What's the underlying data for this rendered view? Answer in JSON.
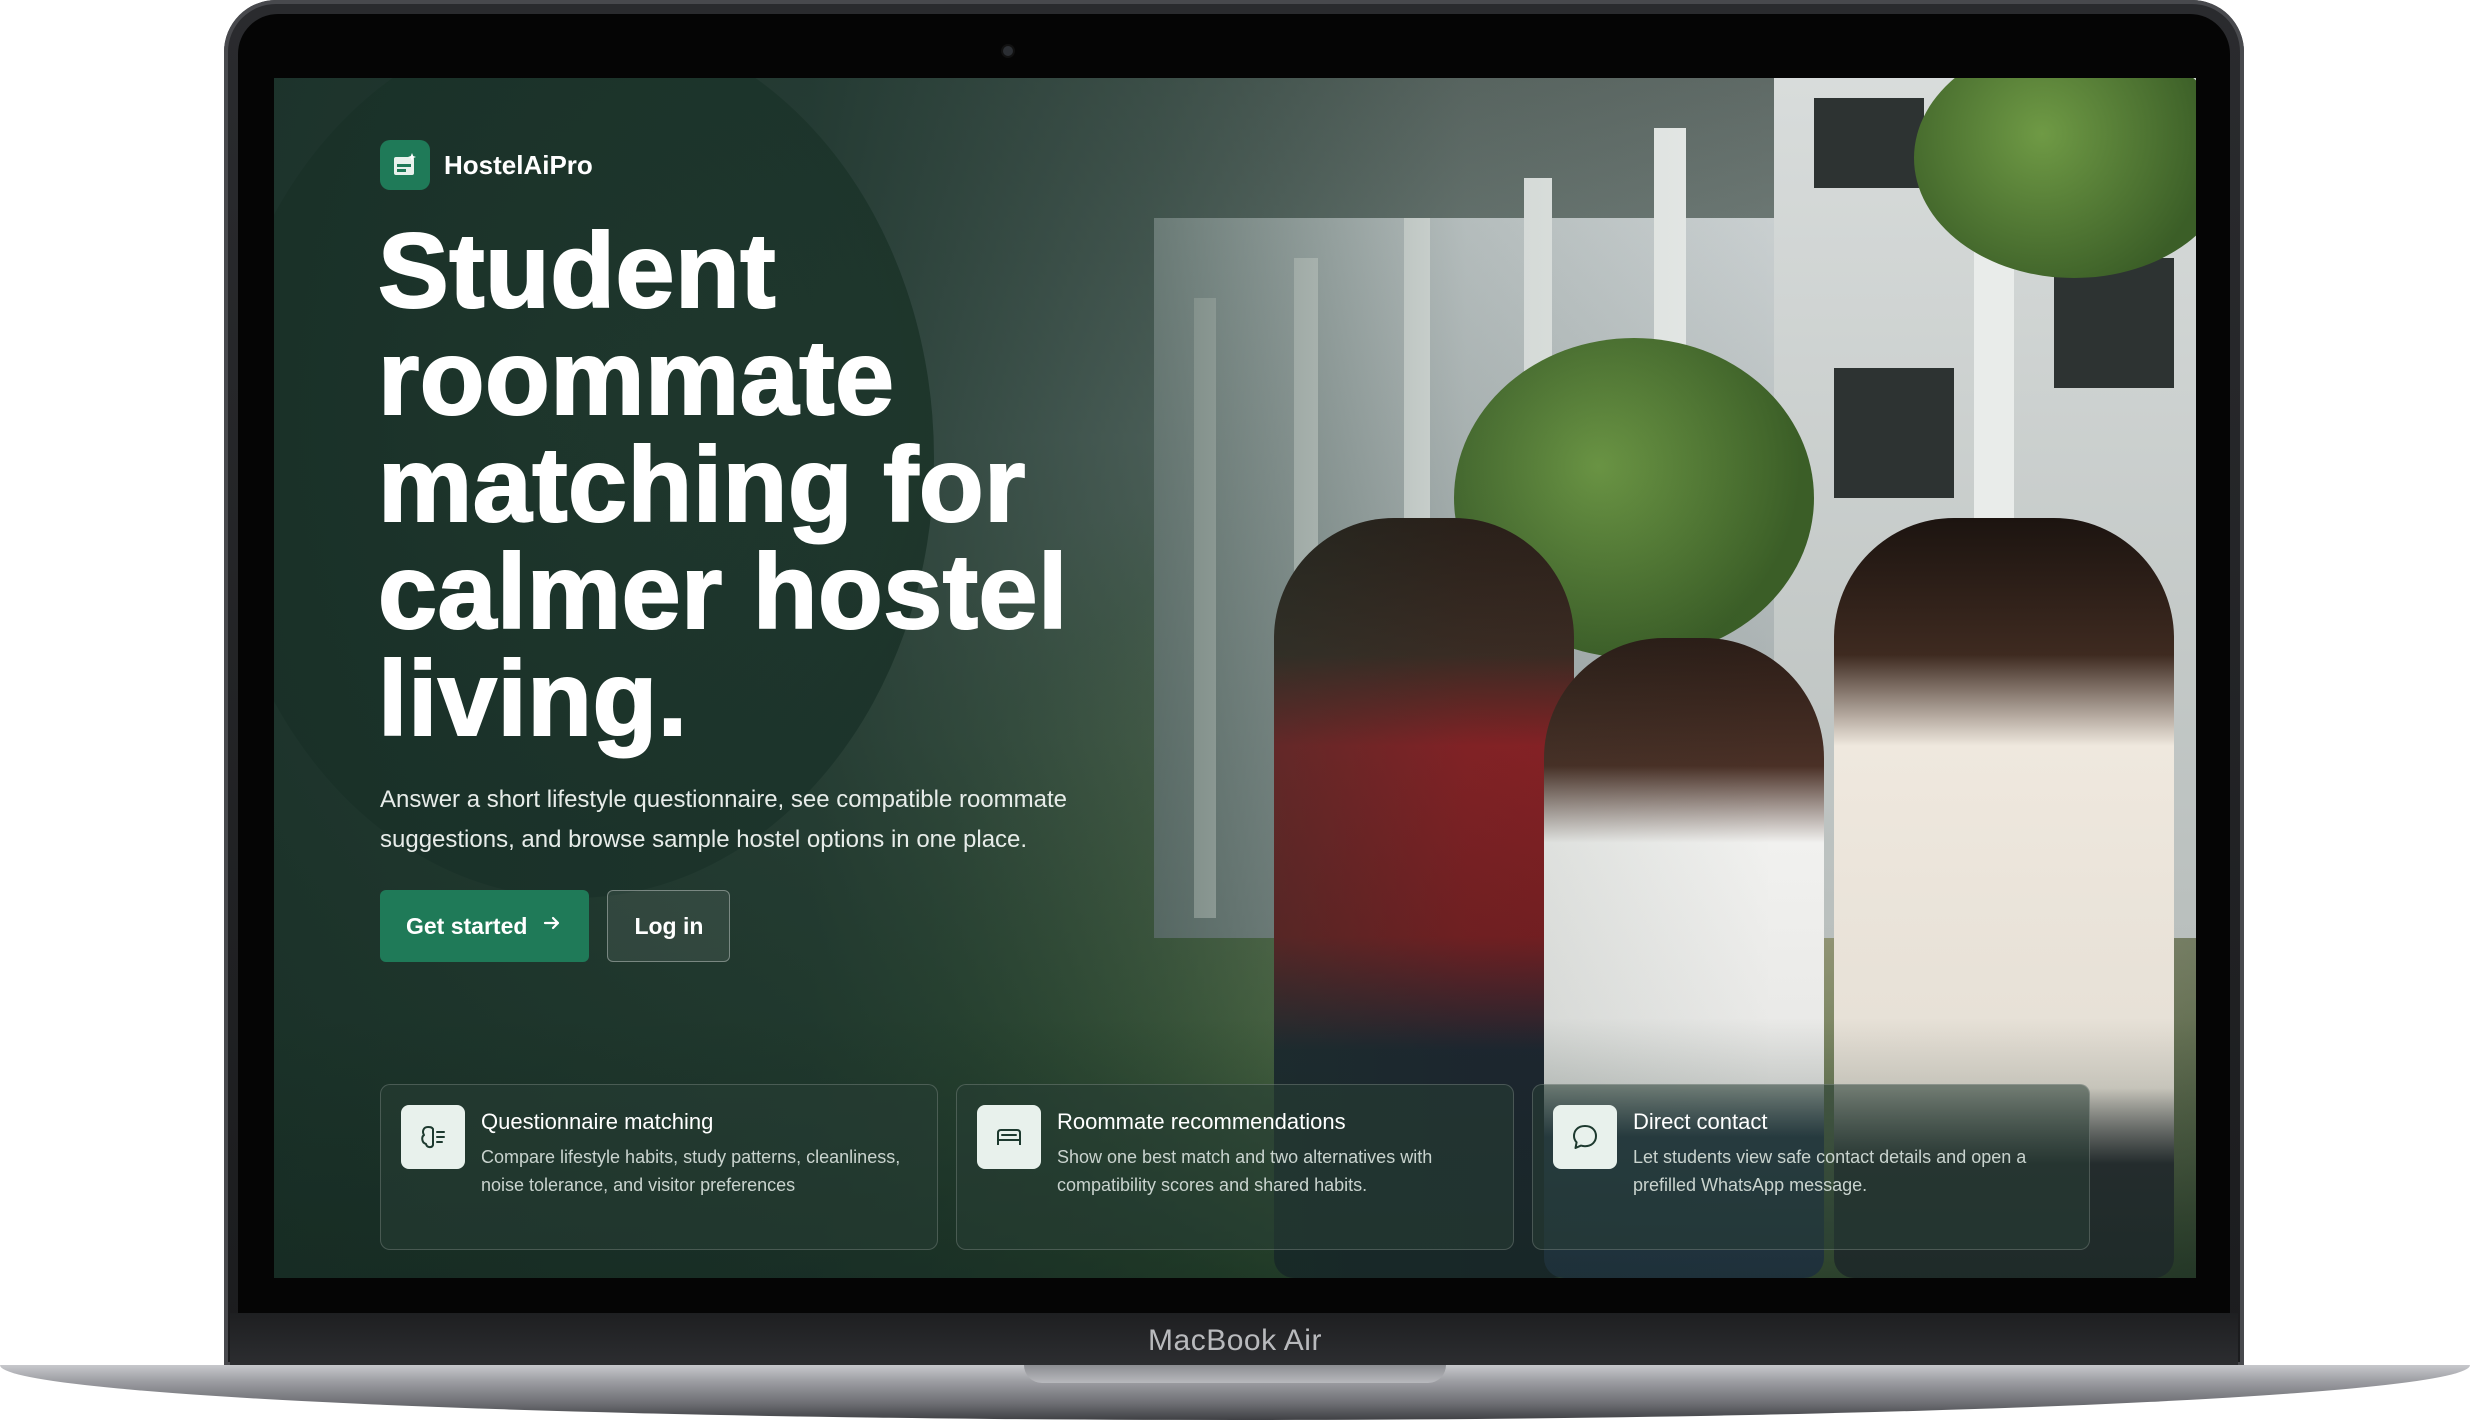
{
  "device": {
    "label": "MacBook Air"
  },
  "brand": {
    "name": "HostelAiPro",
    "icon": "hostel-logo-icon",
    "accent": "#1f7a58"
  },
  "hero": {
    "headline": "Student roommate matching for calmer hostel living.",
    "subtitle": "Answer a short lifestyle questionnaire, see compatible roommate suggestions, and browse sample hostel options in one place.",
    "primary_cta": "Get started",
    "primary_cta_icon": "arrow-right-icon",
    "secondary_cta": "Log in"
  },
  "features": [
    {
      "icon": "questionnaire-icon",
      "title": "Questionnaire matching",
      "description": "Compare lifestyle habits, study patterns, cleanliness, noise tolerance, and visitor preferences"
    },
    {
      "icon": "bed-icon",
      "title": "Roommate recommendations",
      "description": "Show one best match and two alternatives with compatibility scores and shared habits."
    },
    {
      "icon": "chat-bubble-icon",
      "title": "Direct contact",
      "description": "Let students view safe contact details and open a prefilled WhatsApp message."
    }
  ]
}
